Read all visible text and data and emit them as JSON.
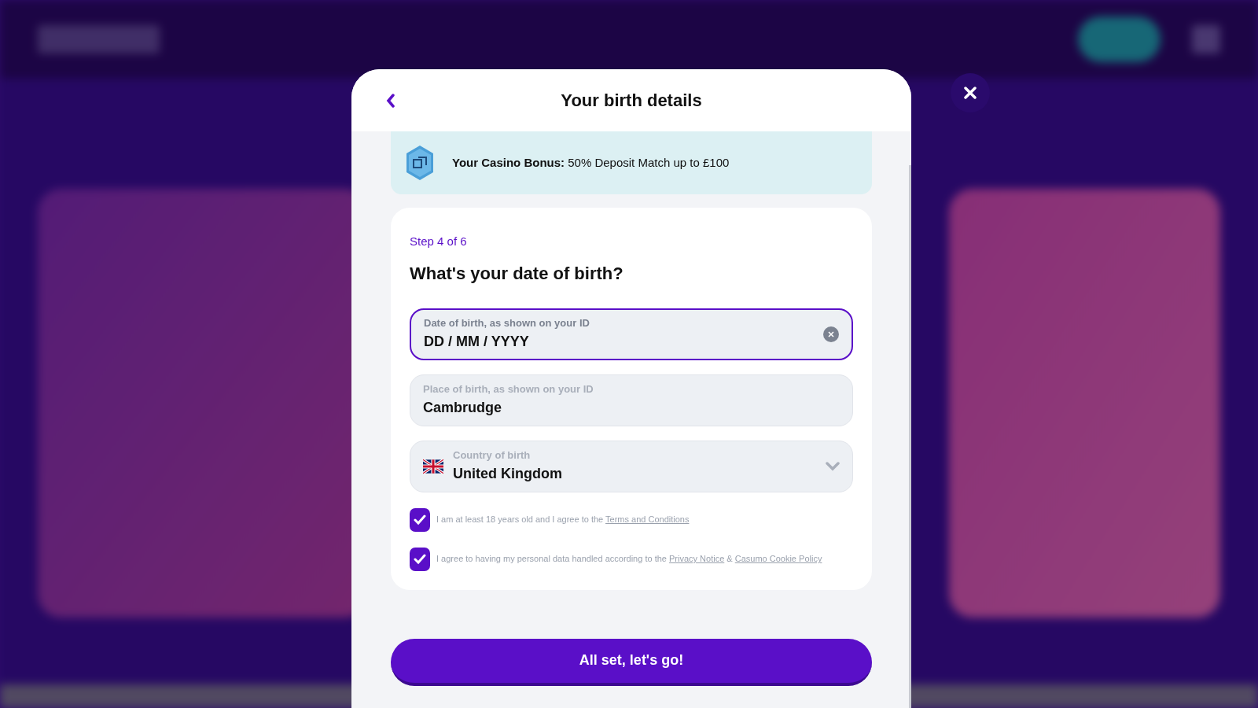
{
  "dialog": {
    "title": "Your birth details",
    "bonus": "**Your Casino Bonus:** 50% Deposit Match up to £100",
    "step": "Step 4 of 6",
    "question": "What's your date of birth?",
    "fields": [
      {
        "kind": "text",
        "label": "Date of birth, as shown on your ID",
        "value": "DD / MM / YYYY",
        "focused": true
      },
      {
        "kind": "text",
        "label": "Place of birth, as shown on your ID",
        "value": "Cambrudge",
        "focused": false
      },
      {
        "kind": "select",
        "label": "Country of birth",
        "value": "United Kingdom",
        "focused": false
      }
    ],
    "consents": [
      {
        "checked": true,
        "parts": [
          {
            "kind": "text",
            "text": "I am at least 18 years old and I agree to the "
          },
          {
            "kind": "link",
            "text": "Terms and Conditions"
          }
        ]
      },
      {
        "checked": true,
        "parts": [
          {
            "kind": "text",
            "text": "I agree to having my personal data handled according to the "
          },
          {
            "kind": "link",
            "text": "Privacy Notice"
          },
          {
            "kind": "text",
            "text": " & "
          },
          {
            "kind": "link",
            "text": "Casumo Cookie Policy"
          }
        ]
      }
    ],
    "submit": "All set, let's go!"
  }
}
